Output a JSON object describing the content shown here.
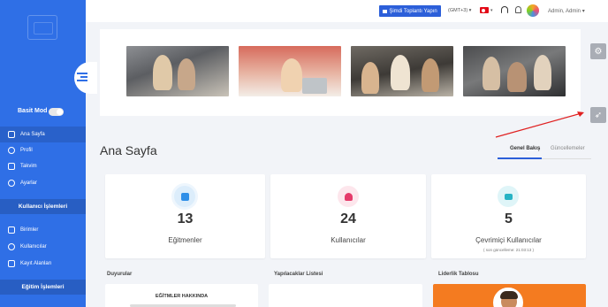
{
  "sidebar": {
    "basic_mode_label": "Basit Mod",
    "items": [
      {
        "label": "Ana Sayfa",
        "icon": "home-icon"
      },
      {
        "label": "Profil",
        "icon": "user-icon"
      },
      {
        "label": "Takvim",
        "icon": "calendar-icon"
      },
      {
        "label": "Ayarlar",
        "icon": "gear-icon"
      }
    ],
    "section_users": "Kullanıcı İşlemleri",
    "user_items": [
      {
        "label": "Birimler",
        "icon": "units-icon"
      },
      {
        "label": "Kullanıcılar",
        "icon": "users-icon"
      },
      {
        "label": "Kayıt Alanları",
        "icon": "form-icon"
      }
    ],
    "section_education": "Eğitim İşlemleri"
  },
  "topbar": {
    "meeting_button": "Şimdi Toplantı Yapın",
    "timezone": "(GMT+3)",
    "user": "Admin, Admin"
  },
  "page": {
    "title": "Ana Sayfa",
    "tabs": [
      "Genel Bakış",
      "Güncellemeler"
    ]
  },
  "stats": [
    {
      "value": "13",
      "label": "Eğitmenler",
      "color": "#2f8fe8",
      "bg": "#dcedfb"
    },
    {
      "value": "24",
      "label": "Kullanıcılar",
      "color": "#e53a6a",
      "bg": "#fde6ec"
    },
    {
      "value": "5",
      "label": "Çevrimiçi Kullanıcılar",
      "sub": "( son güncelleme: 21:03:13 )",
      "color": "#27b3c4",
      "bg": "#dff5f8"
    }
  ],
  "panels": {
    "announcements": {
      "title": "Duyurular",
      "heading": "EĞİTMLER HAKKINDA"
    },
    "todo": {
      "title": "Yapılacaklar Listesi"
    },
    "leaderboard": {
      "title": "Liderlik Tablosu"
    }
  },
  "colors": {
    "sidebar": "#2f6fe6",
    "accent": "#2c5fd9",
    "leaderboard": "#f47b20"
  }
}
